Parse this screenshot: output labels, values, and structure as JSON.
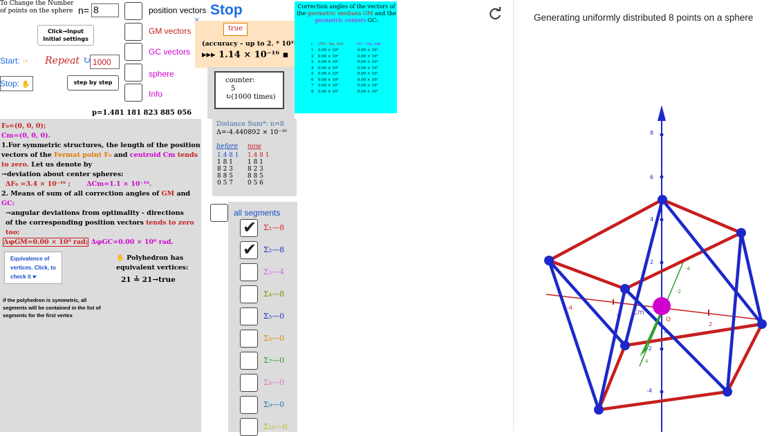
{
  "top_left": {
    "change_number_label": "To Change the Number of points on the sphere",
    "n_label": "n=",
    "n_value": "8"
  },
  "toggles": {
    "position_vectors": "position vectors",
    "gm_vectors": "GM vectors",
    "gc_vectors": "GC vectors",
    "sphere": "sphere",
    "info": "Info"
  },
  "controls": {
    "stop_label": "Stop",
    "close_symbol": "×",
    "click_input": "Click→Input Initial settings",
    "start_label": "Start:",
    "start_icon": "☞",
    "repeat_label": "Repeat",
    "repeat_icon": "↻",
    "repeat_value": "1000",
    "stop_small_label": "Stop:",
    "stop_small_icon": "✋",
    "step_by_step": "step by step"
  },
  "accuracy_box": {
    "true_label": "true",
    "accuracy_text": "(accuracy – up to 2. * 10¹⁵)",
    "accuracy_value": "▸▸▸ 1.14 × 10⁻¹⁶ ▪"
  },
  "counter": {
    "label": "counter:",
    "value": "5",
    "times": "↻(1000 times)"
  },
  "correction_panel": {
    "title_part1": "Correction angles of the vectors of the",
    "title_gm": "geometric medians GM",
    "title_part2": "and the",
    "title_gc": "geometric centers",
    "title_gc2": "GC:",
    "header_i": "i",
    "header_gm": "GM : Δφ, rad",
    "header_gc": "GC : Δφ, rad",
    "rows": [
      {
        "i": "1",
        "gm": "0.00 × 10⁰",
        "gc": "0.00 × 10⁰"
      },
      {
        "i": "2",
        "gm": "0.00 × 10⁰",
        "gc": "0.00 × 10⁰"
      },
      {
        "i": "3",
        "gm": "0.00 × 10⁰",
        "gc": "0.00 × 10⁰"
      },
      {
        "i": "4",
        "gm": "0.00 × 10⁰",
        "gc": "0.00 × 10⁰"
      },
      {
        "i": "5",
        "gm": "0.00 × 10⁰",
        "gc": "0.00 × 10⁰"
      },
      {
        "i": "6",
        "gm": "0.00 × 10⁰",
        "gc": "0.00 × 10⁰"
      },
      {
        "i": "7",
        "gm": "0.00 × 10⁰",
        "gc": "0.00 × 10⁰"
      },
      {
        "i": "8",
        "gm": "0.00 × 10⁰",
        "gc": "0.00 × 10⁰"
      }
    ]
  },
  "p_value": "p=1.481 181 823 885 056",
  "info_panel": {
    "fermat": "F₀=(0, 0, 0);",
    "centroid": "Cm=(0, 0, 0).",
    "point1_a": "1.For symmetric structures, the length of the position vectors of the",
    "fermat_point": "Fermat point F₀",
    "and": "and",
    "centroid_cm": "centroid Cm",
    "tends_zero": "tends to zero.",
    "point1_b": "Let us denote by",
    "deviation": "→deviation about center spheres:",
    "delta_f": "ΔF₀ =3.4 × 10⁻¹⁶ ;",
    "delta_cm": "ΔCm=1.1 × 10⁻¹⁶.",
    "point2_a": "2. Means of sum of all correction angles of",
    "gm": "GM",
    "and2": "and",
    "gc": "GC:",
    "angular": "→angular deviations from optimality - directions",
    "point2_b": "of the corresponding position vectors",
    "tends_zero_too": "tends to zero too:",
    "delta_gm": "ΔφGM=0.00 × 10⁰ rad;",
    "delta_gc": "ΔφGC=0.00 × 10⁰ rad."
  },
  "distance_panel": {
    "title": "Distance Sum*: n=8",
    "delta": "Δ=-4.440892 × 10⁻¹⁶",
    "before_label": "before",
    "now_label": "now",
    "before_lines": [
      "1.4 8 1",
      "1 8 1",
      "8 2 3",
      "8 8 5",
      "0 5 7"
    ],
    "now_lines": [
      "1.4 8 1",
      "1 8 1",
      "8 2 3",
      "8 8 5",
      "0 5 6"
    ]
  },
  "equivalence": {
    "text": "Equivalence of vertices. Click, to check it ☛",
    "polyhedron": "✋ Polyhedron has equivalent vertices:",
    "result": "21 ≟ 21→true",
    "note": "if the polyhedron is symmetric, all segments will be contained in the list of segments for the first vertex"
  },
  "segments": {
    "all_label": "all segments",
    "items": [
      {
        "label": "Σ₁—8",
        "color": "#d62728",
        "checked": true
      },
      {
        "label": "Σ₂—8",
        "color": "#1f2fbf",
        "checked": true
      },
      {
        "label": "Σ₃—4",
        "color": "#cc66ff",
        "checked": false
      },
      {
        "label": "Σ₄—8",
        "color": "#8b8b00",
        "checked": false
      },
      {
        "label": "Σ₅—0",
        "color": "#1f2fbf",
        "checked": false
      },
      {
        "label": "Σ₆—0",
        "color": "#e08a00",
        "checked": false
      },
      {
        "label": "Σ₇—0",
        "color": "#2ca02c",
        "checked": false
      },
      {
        "label": "Σ₈—0",
        "color": "#e377c2",
        "checked": false
      },
      {
        "label": "Σ₉—0",
        "color": "#1f77b4",
        "checked": false
      },
      {
        "label": "Σ₁₀—0",
        "color": "#bcbd22",
        "checked": false
      }
    ]
  },
  "graphics": {
    "heading": "Generating uniformly distributed  8 points on a sphere",
    "refresh_icon": "refresh-icon",
    "axis_labels_z": [
      "8",
      "6",
      "4",
      "2",
      "-2",
      "-4"
    ],
    "axis_labels_x": [
      "-4",
      "-2",
      "2"
    ],
    "axis_labels_y": [
      "4",
      "2",
      "-2",
      "-4"
    ],
    "origin": "O",
    "center_label": "Cm"
  },
  "colors": {
    "red": "#c81e1e",
    "blue": "#1c28c8",
    "magenta": "#d000d0",
    "cyan": "#00ffff",
    "peach": "#ffe3c0"
  }
}
